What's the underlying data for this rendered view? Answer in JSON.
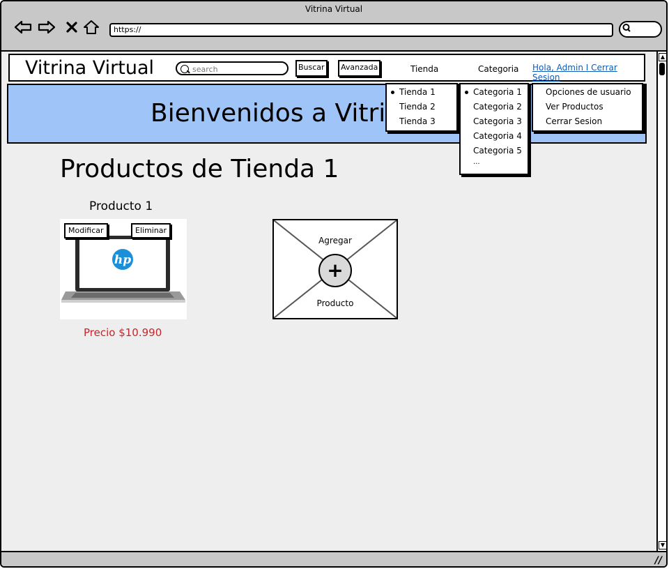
{
  "browser": {
    "title": "Vitrina Virtual",
    "url": "https://",
    "icons": [
      "back-arrow-icon",
      "forward-arrow-icon",
      "close-icon",
      "home-icon",
      "search-icon"
    ]
  },
  "header": {
    "brand": "Vitrina Virtual",
    "search_placeholder": "search",
    "buscar": "Buscar",
    "avanzada": "Avanzada",
    "menu_tienda": "Tienda",
    "menu_categoria": "Categoria",
    "user_link": "Hola, Admin I Cerrar Sesion"
  },
  "banner": {
    "text": "Bienvenidos a Vitrina Virtual"
  },
  "dropdowns": {
    "tienda": [
      "Tienda 1",
      "Tienda 2",
      "Tienda 3"
    ],
    "categoria": [
      "Categoria 1",
      "Categoria 2",
      "Categoria 3",
      "Categoria 4",
      "Categoria 5",
      "..."
    ],
    "usuario": [
      "Opciones de usuario",
      "Ver Productos",
      "Cerrar Sesion"
    ]
  },
  "main": {
    "title": "Productos de Tienda 1",
    "product": {
      "name": "Producto 1",
      "modificar": "Modificar",
      "eliminar": "Eliminar",
      "price": "Precio $10.990",
      "logo": "hp"
    },
    "add_card": {
      "top": "Agregar",
      "bottom": "Producto"
    }
  },
  "colors": {
    "banner": "#9ec4f8",
    "link": "#0b5cb8",
    "price": "#c8242b",
    "chrome": "#c8c8c8",
    "canvas": "#eeeeee"
  }
}
